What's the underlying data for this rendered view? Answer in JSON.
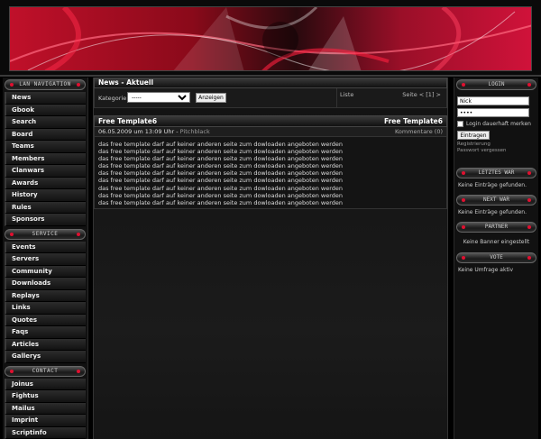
{
  "header": {
    "banner": "decorative-red-abstract-banner"
  },
  "left": {
    "navigation_title": "LAN NAVIGATION",
    "navigation": [
      "News",
      "Gbook",
      "Search",
      "Board",
      "Teams",
      "Members",
      "Clanwars",
      "Awards",
      "History",
      "Rules",
      "Sponsors"
    ],
    "service_title": "SERVICE",
    "service": [
      "Events",
      "Servers",
      "Community",
      "Downloads",
      "Replays",
      "Links",
      "Quotes",
      "Faqs",
      "Articles",
      "Gallerys"
    ],
    "contact_title": "CONTACT",
    "contact": [
      "Joinus",
      "Fightus",
      "Mailus",
      "Imprint",
      "Scriptinfo"
    ]
  },
  "center": {
    "section_title": "News - Aktuell",
    "filter": {
      "label": "Kategorie",
      "selected": "-----",
      "button": "Anzeigen",
      "liste": "Liste",
      "page": "Seite < [1] >"
    },
    "news": {
      "title_left": "Free Template6",
      "title_right": "Free Template6",
      "date": "06.05.2009 um 13:09 Uhr",
      "author_sep": " - ",
      "author": "Pitchblack",
      "comments": "Kommentare (0)",
      "lines": [
        "das free template darf auf keiner anderen seite zum dowloaden angeboten werden",
        "das free template darf auf keiner anderen seite zum dowloaden angeboten werden",
        "das free template darf auf keiner anderen seite zum dowloaden angeboten werden",
        "das free template darf auf keiner anderen seite zum dowloaden angeboten werden",
        "das free template darf auf keiner anderen seite zum dowloaden angeboten werden",
        "das free template darf auf keiner anderen seite zum dowloaden angeboten werden",
        "das free template darf auf keiner anderen seite zum dowloaden angeboten werden",
        "das free template darf auf keiner anderen seite zum dowloaden angeboten werden",
        "das free template darf auf keiner anderen seite zum dowloaden angeboten werden"
      ]
    }
  },
  "right": {
    "login_title": "LOGIN",
    "username": "Nick",
    "password": "••••",
    "remember": "Login dauerhaft merken",
    "submit": "Eintragen",
    "register": "Registrierung",
    "forgot": "Passwort vergessen",
    "latest_title": "LETZTES WAR",
    "latest_text": "Keine Einträge gefunden.",
    "next_title": "NEXT WAR",
    "next_text": "Keine Einträge gefunden.",
    "partner_title": "PARTNER",
    "partner_text": "Keine Banner eingestellt",
    "vote_title": "VOTE",
    "vote_text": "Keine Umfrage aktiv"
  },
  "colors": {
    "accent": "#e01030",
    "background": "#000000",
    "panel": "#141414"
  }
}
